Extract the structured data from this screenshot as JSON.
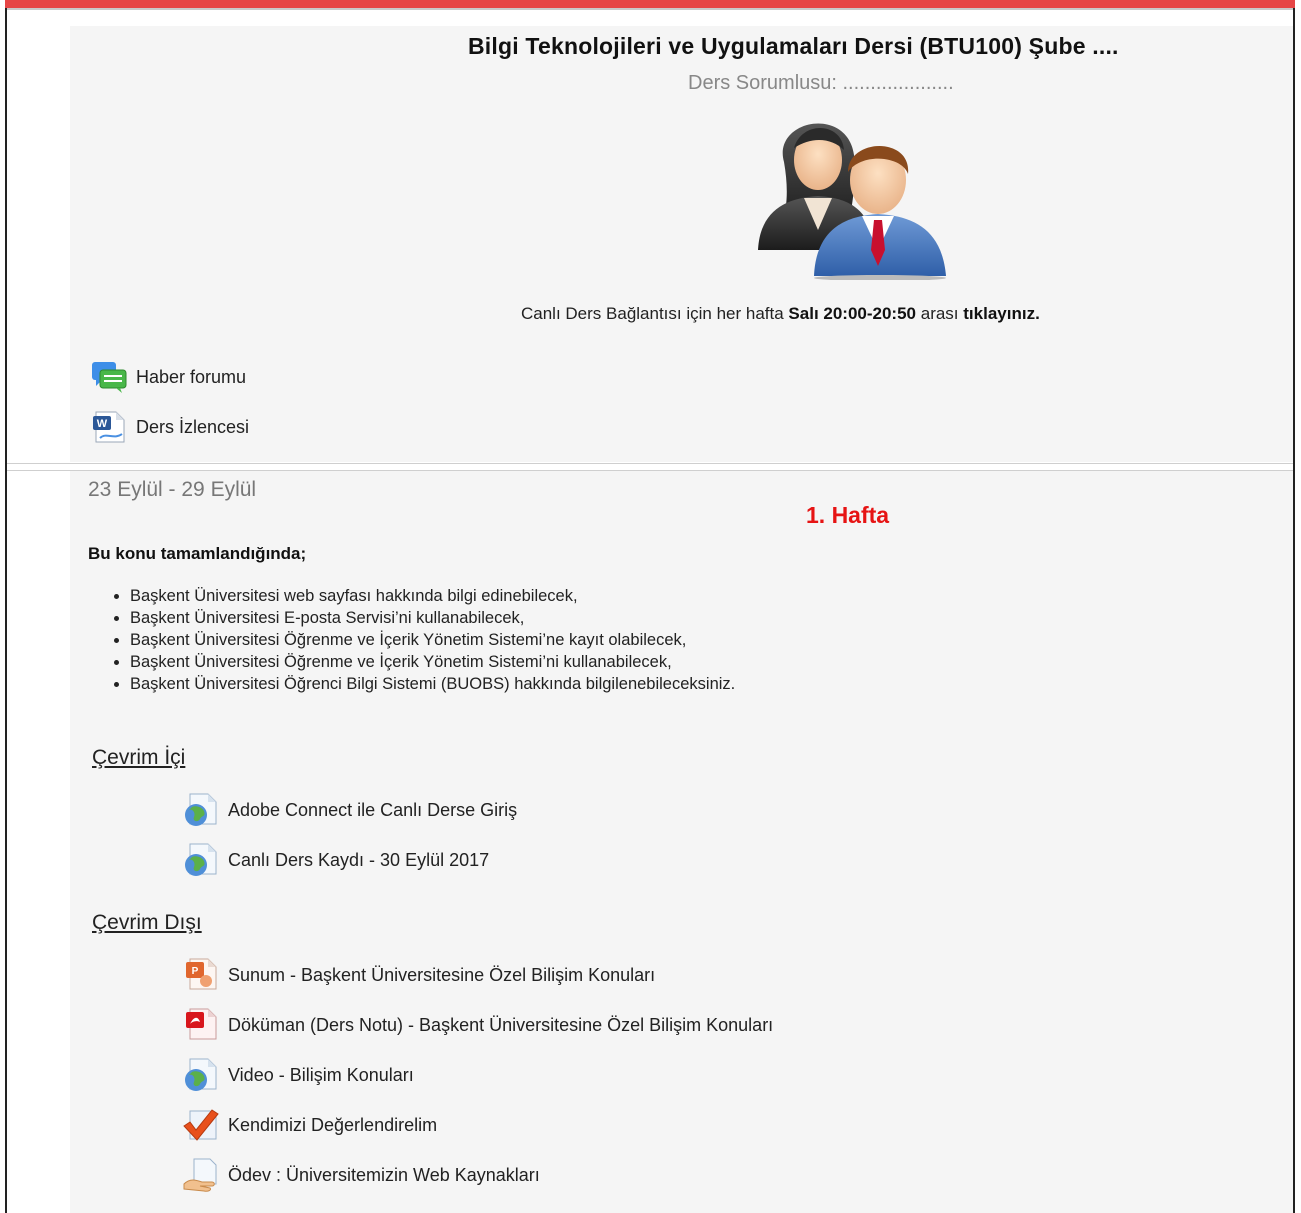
{
  "header": {
    "course_title": "Bilgi Teknolojileri ve Uygulamaları Dersi (BTU100) Şube ....",
    "instructor_line": "Ders Sorumlusu: ....................",
    "live_prefix": "Canlı Ders Bağlantısı için her hafta ",
    "live_time": "Salı 20:00-20:50",
    "live_mid": " arası ",
    "live_link": "tıklayınız."
  },
  "general_activities": [
    {
      "label": "Haber forumu",
      "icon": "forum-icon"
    },
    {
      "label": "Ders İzlencesi",
      "icon": "word-document-icon"
    }
  ],
  "week1": {
    "dates": "23 Eylül - 29 Eylül",
    "title": "1. Hafta",
    "summary_heading": "Bu konu tamamlandığında;",
    "outcomes": [
      "Başkent Üniversitesi web sayfası hakkında bilgi edinebilecek,",
      "Başkent Üniversitesi E-posta Servisi’ni kullanabilecek,",
      "Başkent Üniversitesi Öğrenme ve İçerik Yönetim Sistemi’ne kayıt olabilecek,",
      "Başkent Üniversitesi Öğrenme ve İçerik Yönetim Sistemi’ni kullanabilecek,",
      "Başkent Üniversitesi Öğrenci Bilgi Sistemi (BUOBS) hakkında bilgilenebileceksiniz."
    ],
    "online_heading": "Çevrim İçi",
    "online_items": [
      {
        "label": "Adobe Connect ile Canlı Derse Giriş",
        "icon": "url-globe-icon"
      },
      {
        "label": "Canlı Ders Kaydı - 30 Eylül 2017",
        "icon": "url-globe-icon"
      }
    ],
    "offline_heading": "Çevrim Dışı",
    "offline_items": [
      {
        "label": "Sunum - Başkent Üniversitesine Özel Bilişim Konuları",
        "icon": "powerpoint-icon"
      },
      {
        "label": "Döküman (Ders Notu) - Başkent Üniversitesine Özel Bilişim Konuları",
        "icon": "pdf-icon"
      },
      {
        "label": "Video - Bilişim Konuları",
        "icon": "url-globe-icon"
      },
      {
        "label": "Kendimizi Değerlendirelim",
        "icon": "quiz-checkmark-icon"
      },
      {
        "label": "Ödev : Üniversitemizin Web Kaynakları",
        "icon": "assignment-icon"
      }
    ]
  },
  "colors": {
    "accent_bar": "#e64545",
    "week_title": "#e61414",
    "section_bg": "#f5f5f5"
  }
}
